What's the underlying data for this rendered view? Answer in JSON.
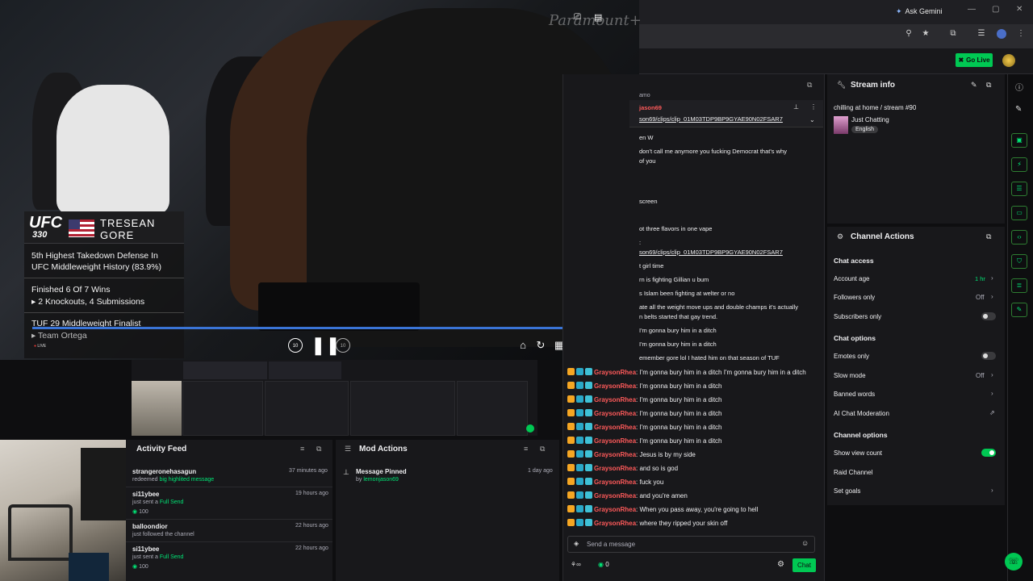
{
  "browser": {
    "ask_gemini": "Ask Gemini"
  },
  "topbar": {
    "go_live": "Go Live"
  },
  "video": {
    "brand": "Paramount+",
    "overlay": {
      "event_logo": "UFC",
      "event_number": "330",
      "first_name": "TRESEAN",
      "last_name": "GORE",
      "stat1_line1": "5th Highest Takedown Defense In",
      "stat1_line2": "UFC Middleweight History (83.9%)",
      "stat2_line1": "Finished 6 Of 7 Wins",
      "stat2_line2": "▸ 2 Knockouts, 4 Submissions",
      "stat3_line1": "TUF 29 Middleweight Finalist",
      "stat3_line2": "▸ Team Ortega",
      "live": "LIVE"
    },
    "skip_back": "10",
    "skip_fwd": "10",
    "volume_fraction": 0.4
  },
  "activity": {
    "title": "Activity Feed",
    "items": [
      {
        "name": "strangeronehasagun",
        "action": "redeemed",
        "detail": "big highlited message",
        "time": "37 minutes ago",
        "points": ""
      },
      {
        "name": "si11ybee",
        "action": "just sent a",
        "detail": "Full Send",
        "time": "19 hours ago",
        "points": "100"
      },
      {
        "name": "balloondior",
        "action": "just followed the channel",
        "detail": "",
        "time": "22 hours ago",
        "points": ""
      },
      {
        "name": "si11ybee",
        "action": "just sent a",
        "detail": "Full Send",
        "time": "22 hours ago",
        "points": "100"
      }
    ]
  },
  "mod_actions": {
    "title": "Mod Actions",
    "items": [
      {
        "title": "Message Pinned",
        "by": "by",
        "user": "lemonjason69",
        "time": "1 day ago"
      }
    ]
  },
  "chat": {
    "pinned_user": "jason69",
    "pinned_link": "son69/clips/clip_01M03TDP9BP9GYAE90N02FSAR7",
    "top_partial": "amo",
    "partial_lines": [
      "en W",
      "don't call me anymore you fucking Democrat that's why",
      "of you",
      "screen",
      "ot three flavors in one vape",
      ":",
      "son69/clips/clip_01M03TDP9BP9GYAE90N02FSAR7",
      "t girl time",
      "rn is fighting Gillian u bum",
      "s Islam been fighting at welter or no",
      "ate all the weight move ups and double champs it's actually",
      "n belts started that gay trend.",
      "I'm gonna bury him in a ditch",
      "I'm gonna bury him in a ditch",
      "emember gore lol I hated him on that season of TUF"
    ],
    "username": "GraysonRhea",
    "messages": [
      "I'm gonna bury him in a ditch I'm gonna bury him in a ditch",
      "I'm gonna bury him in a ditch",
      "I'm gonna bury him in a ditch",
      "I'm gonna bury him in a ditch",
      "I'm gonna bury him in a ditch",
      "I'm gonna bury him in a ditch",
      "Jesus is by my side",
      "and so is god",
      "fuck you",
      "and you're amen",
      "When you pass away, you're going to hell",
      "where they ripped your skin off"
    ],
    "input_placeholder": "Send a message",
    "points": "0",
    "chat_button": "Chat"
  },
  "stream_info": {
    "title": "Stream info",
    "stream_title": "chilling at home / stream #90",
    "category": "Just Chatting",
    "language": "English"
  },
  "channel_actions": {
    "title": "Channel Actions",
    "chat_access_header": "Chat access",
    "account_age": "Account age",
    "account_age_value": "1 hr",
    "followers_only": "Followers only",
    "followers_only_value": "Off",
    "subscribers_only": "Subscribers only",
    "chat_options_header": "Chat options",
    "emotes_only": "Emotes only",
    "slow_mode": "Slow mode",
    "slow_mode_value": "Off",
    "banned_words": "Banned words",
    "ai_moderation": "AI Chat Moderation",
    "channel_options_header": "Channel options",
    "show_view_count": "Show view count",
    "raid_channel": "Raid Channel",
    "set_goals": "Set goals"
  }
}
